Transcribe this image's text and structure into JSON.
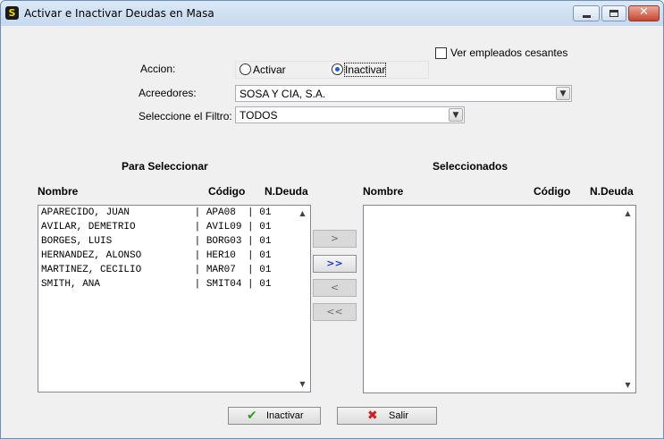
{
  "window": {
    "title": "Activar e Inactivar Deudas en Masa",
    "icon": "app-shield-icon",
    "controls": {
      "minimize": "minimize-icon",
      "maximize": "maximize-icon",
      "close": "✕"
    }
  },
  "options": {
    "show_former_employees_label": "Ver empleados cesantes",
    "show_former_employees_checked": false
  },
  "form": {
    "action_label": "Accion:",
    "action_options": [
      {
        "label": "Activar",
        "selected": false
      },
      {
        "label": "Inactivar",
        "selected": true
      }
    ],
    "creditors_label": "Acreedores:",
    "creditors_value": "SOSA Y CIA, S.A.",
    "filter_label": "Seleccione el Filtro:",
    "filter_value": "TODOS"
  },
  "left_panel": {
    "title": "Para Seleccionar",
    "columns": [
      "Nombre",
      "Código",
      "N.Deuda"
    ],
    "rows": [
      {
        "name": "APARECIDO, JUAN",
        "code": "APA08",
        "debt": "01"
      },
      {
        "name": "AVILAR, DEMETRIO",
        "code": "AVIL09",
        "debt": "01"
      },
      {
        "name": "BORGES, LUIS",
        "code": "BORG03",
        "debt": "01"
      },
      {
        "name": "HERNANDEZ, ALONSO",
        "code": "HER10",
        "debt": "01"
      },
      {
        "name": "MARTINEZ, CECILIO",
        "code": "MAR07",
        "debt": "01"
      },
      {
        "name": "SMITH, ANA",
        "code": "SMIT04",
        "debt": "01"
      }
    ]
  },
  "right_panel": {
    "title": "Seleccionados",
    "columns": [
      "Nombre",
      "Código",
      "N.Deuda"
    ],
    "rows": []
  },
  "move_buttons": [
    {
      "label": ">",
      "enabled": false
    },
    {
      "label": ">>",
      "enabled": true
    },
    {
      "label": "<",
      "enabled": false
    },
    {
      "label": "<<",
      "enabled": false
    }
  ],
  "actions": {
    "inactivate_label": "Inactivar",
    "inactivate_icon": "checkmark-icon",
    "exit_label": "Salir",
    "exit_icon": "x-icon"
  },
  "colors": {
    "check_green": "#2f9e1f",
    "exit_red": "#d41c1c",
    "radio_dot": "#1c63c7",
    "active_move_text": "#1733c9"
  }
}
